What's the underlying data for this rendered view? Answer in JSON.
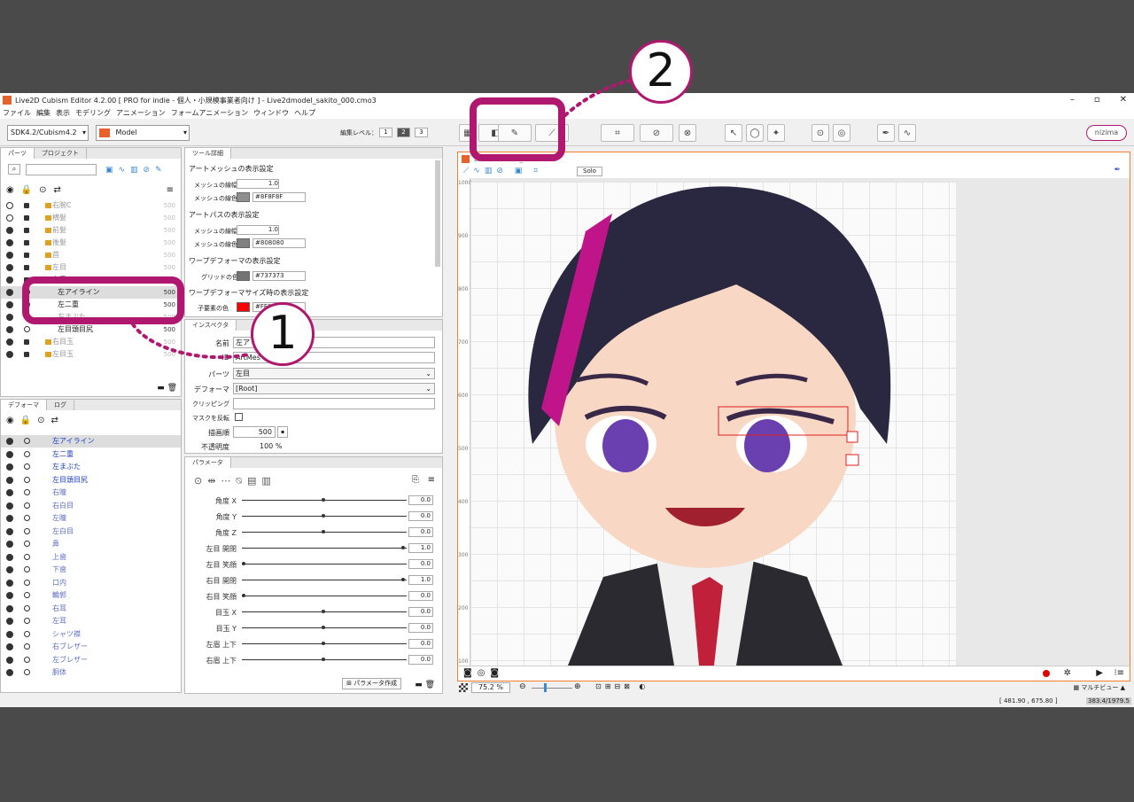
{
  "window": {
    "title": "Live2D Cubism Editor 4.2.00   [ PRO for indie - 個人・小規模事業者向け ]  - Live2dmodel_sakito_000.cmo3"
  },
  "menu": [
    "ファイル",
    "編集",
    "表示",
    "モデリング",
    "アニメーション",
    "フォームアニメーション",
    "ウィンドウ",
    "ヘルプ"
  ],
  "toolbar": {
    "sdk_select": "SDK4.2/Cubism4.2",
    "mode_select": "Model",
    "edit_level_label": "編集レベル：",
    "levels": [
      "1",
      "2",
      "3"
    ],
    "nizima": "nizima",
    "solo": "Solo"
  },
  "parts_panel": {
    "tabs": [
      "パーツ",
      "プロジェクト"
    ],
    "items": [
      {
        "label": "右腕C",
        "num": "500",
        "dim": true,
        "folder": true
      },
      {
        "label": "横髪",
        "num": "500",
        "dim": true,
        "folder": true
      },
      {
        "label": "前髪",
        "num": "500",
        "dim": true,
        "folder": true
      },
      {
        "label": "後髪",
        "num": "500",
        "dim": true,
        "folder": true
      },
      {
        "label": "首",
        "num": "500",
        "dim": true,
        "folder": true
      },
      {
        "label": "左目",
        "num": "500",
        "dim": true,
        "folder": true
      },
      {
        "label": "左目",
        "num": "",
        "dim": false,
        "folder": true
      },
      {
        "label": "左アイライン",
        "num": "500",
        "dim": false,
        "folder": false
      },
      {
        "label": "左二重",
        "num": "500",
        "dim": false,
        "folder": false
      },
      {
        "label": "左まぶた",
        "num": "500",
        "dim": true,
        "folder": false
      },
      {
        "label": "左目頭目尻",
        "num": "500",
        "dim": false,
        "folder": false
      },
      {
        "label": "右目玉",
        "num": "500",
        "dim": true,
        "folder": true
      },
      {
        "label": "左目玉",
        "num": "500",
        "dim": true,
        "folder": true
      }
    ]
  },
  "deformer_panel": {
    "tabs": [
      "デフォーマ",
      "ログ"
    ],
    "items": [
      "左アイライン",
      "左二重",
      "左まぶた",
      "左目頭目尻",
      "右瞳",
      "右白目",
      "左瞳",
      "左白目",
      "鼻",
      "上歯",
      "下歯",
      "口内",
      "輪郭",
      "右耳",
      "左耳",
      "シャツ襟",
      "右ブレザー",
      "左ブレザー",
      "胴体"
    ]
  },
  "tool_detail": {
    "tab": "ツール詳細",
    "sections": [
      {
        "title": "アートメッシュの表示設定",
        "width_label": "メッシュの線幅",
        "width_value": "1.0",
        "color_label": "メッシュの線色",
        "color_value": "#8F8F8F",
        "swatch": "#8f8f8f"
      },
      {
        "title": "アートパスの表示設定",
        "width_label": "メッシュの線幅",
        "width_value": "1.0",
        "color_label": "メッシュの線色",
        "color_value": "#808080",
        "swatch": "#808080"
      }
    ],
    "warp_title": "ワープデフォーマの表示設定",
    "grid_label": "グリッドの色",
    "grid_value": "#737373",
    "warp_size_title": "ワープデフォーマサイズ時の表示設定",
    "child_label": "子要素の色",
    "child_value": "#FF0000"
  },
  "inspector": {
    "tab": "インスペクタ",
    "name_label": "名前",
    "name_value": "左ア",
    "id_label": "ID",
    "id_value": "ArtMes",
    "parts_label": "パーツ",
    "parts_value": "左目",
    "deformer_label": "デフォーマ",
    "deformer_value": "[Root]",
    "clipping_label": "クリッピング",
    "invert_mask_label": "マスクを反転",
    "draw_order_label": "描画順",
    "draw_order_value": "500",
    "opacity_label": "不透明度",
    "opacity_value": "100 %"
  },
  "parameters": {
    "tab": "パラメータ",
    "items": [
      {
        "name": "角度 X",
        "value": "0.0",
        "pos": 0.5
      },
      {
        "name": "角度 Y",
        "value": "0.0",
        "pos": 0.5
      },
      {
        "name": "角度 Z",
        "value": "0.0",
        "pos": 0.5
      },
      {
        "name": "左目 開閉",
        "value": "1.0",
        "pos": 1.0
      },
      {
        "name": "左目 笑顔",
        "value": "0.0",
        "pos": 0.0
      },
      {
        "name": "右目 開閉",
        "value": "1.0",
        "pos": 1.0
      },
      {
        "name": "右目 笑顔",
        "value": "0.0",
        "pos": 0.0
      },
      {
        "name": "目玉 X",
        "value": "0.0",
        "pos": 0.5
      },
      {
        "name": "目玉 Y",
        "value": "0.0",
        "pos": 0.5
      },
      {
        "name": "左眉 上下",
        "value": "0.0",
        "pos": 0.5
      },
      {
        "name": "右眉 上下",
        "value": "0.0",
        "pos": 0.5
      }
    ],
    "create_button": "パラメータ作成"
  },
  "viewport": {
    "tab": "Live2dmodel_sakit",
    "ruler": [
      "1000",
      "900",
      "800",
      "700",
      "600",
      "500",
      "400",
      "300",
      "200",
      "100"
    ],
    "zoom": "75.2 %",
    "multi_view": "マルチビュー",
    "coords": "[  481.90 ,  675.80 ]",
    "mem": "383.4/1979.5"
  },
  "annotations": {
    "one": "1",
    "two": "2"
  }
}
